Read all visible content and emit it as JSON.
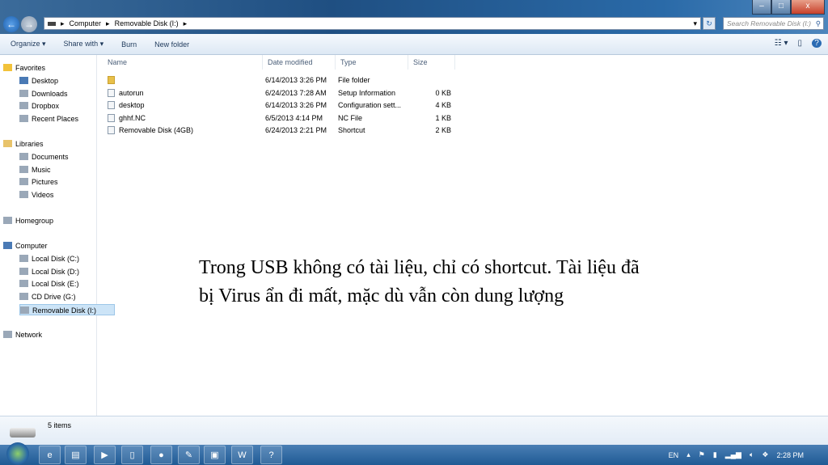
{
  "window": {
    "minimize": "–",
    "maximize": "□",
    "close": "x"
  },
  "address": {
    "crumbs": [
      "Computer",
      "Removable Disk (I:)"
    ],
    "search_placeholder": "Search Removable Disk (I:)"
  },
  "toolbar": {
    "organize": "Organize ▾",
    "share": "Share with ▾",
    "burn": "Burn",
    "new_folder": "New folder",
    "views": "☷ ▾",
    "preview": "▯",
    "help": "?"
  },
  "sidebar": {
    "items": [
      {
        "label": "Favorites",
        "icon": "star-icon",
        "level": 0
      },
      {
        "label": "Desktop",
        "icon": "desktop-icon",
        "level": 1
      },
      {
        "label": "Downloads",
        "icon": "downloads-icon",
        "level": 1
      },
      {
        "label": "Dropbox",
        "icon": "dropbox-icon",
        "level": 1
      },
      {
        "label": "Recent Places",
        "icon": "recent-places-icon",
        "level": 1
      },
      {
        "label": "Libraries",
        "icon": "libraries-icon",
        "level": 0
      },
      {
        "label": "Documents",
        "icon": "documents-icon",
        "level": 1
      },
      {
        "label": "Music",
        "icon": "music-icon",
        "level": 1
      },
      {
        "label": "Pictures",
        "icon": "pictures-icon",
        "level": 1
      },
      {
        "label": "Videos",
        "icon": "videos-icon",
        "level": 1
      },
      {
        "label": "Homegroup",
        "icon": "homegroup-icon",
        "level": 0
      },
      {
        "label": "Computer",
        "icon": "computer-icon",
        "level": 0
      },
      {
        "label": "Local Disk (C:)",
        "icon": "disk-icon",
        "level": 1
      },
      {
        "label": "Local Disk (D:)",
        "icon": "disk-icon",
        "level": 1
      },
      {
        "label": "Local Disk (E:)",
        "icon": "disk-icon",
        "level": 1
      },
      {
        "label": "CD Drive (G:)",
        "icon": "cd-icon",
        "level": 1
      },
      {
        "label": "Removable Disk (I:)",
        "icon": "usb-icon",
        "level": 1,
        "selected": true
      },
      {
        "label": "Network",
        "icon": "network-icon",
        "level": 0
      }
    ]
  },
  "columns": [
    "Name",
    "Date modified",
    "Type",
    "Size"
  ],
  "files": [
    {
      "name": "",
      "date": "6/14/2013 3:26 PM",
      "type": "File folder",
      "size": "",
      "icon": "folder-icon"
    },
    {
      "name": "autorun",
      "date": "6/24/2013 7:28 AM",
      "type": "Setup Information",
      "size": "0 KB",
      "icon": "settings-file-icon"
    },
    {
      "name": "desktop",
      "date": "6/14/2013 3:26 PM",
      "type": "Configuration sett...",
      "size": "4 KB",
      "icon": "settings-file-icon"
    },
    {
      "name": "ghhf.NC",
      "date": "6/5/2013 4:14 PM",
      "type": "NC File",
      "size": "1 KB",
      "icon": "file-icon"
    },
    {
      "name": "Removable Disk (4GB)",
      "date": "6/24/2013 2:21 PM",
      "type": "Shortcut",
      "size": "2 KB",
      "icon": "shortcut-icon"
    }
  ],
  "note": "Trong USB không có tài liệu, chỉ có shortcut. Tài liệu đã bị Virus ẩn đi mất, mặc dù vẫn còn dung lượng",
  "status": {
    "count": "5 items"
  },
  "taskbar": {
    "language": "EN",
    "clock": "2:28 PM",
    "apps": [
      "ie-icon",
      "explorer-icon",
      "media-player-icon",
      "notepad-icon",
      "firefox-icon",
      "paint-icon",
      "window-icon",
      "word-icon",
      "help-icon"
    ]
  }
}
